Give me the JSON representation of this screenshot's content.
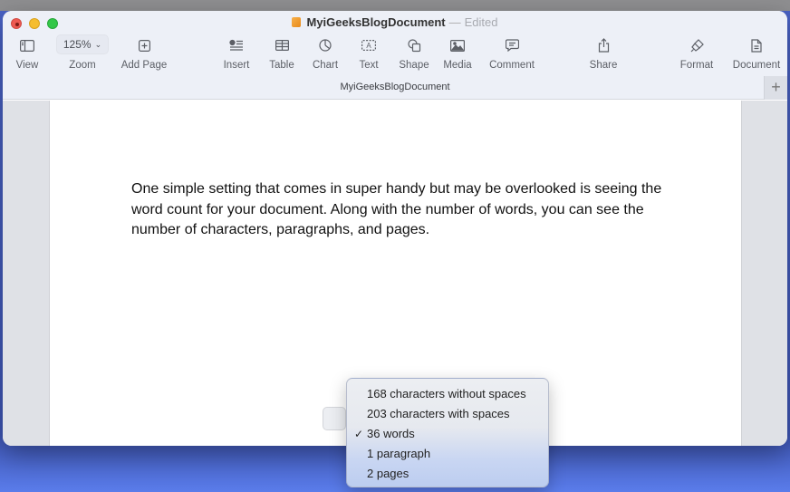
{
  "window": {
    "doc_title": "MyiGeeksBlogDocument",
    "separator": "—",
    "status": "Edited",
    "subtitle": "MyiGeeksBlogDocument"
  },
  "toolbar": {
    "view": "View",
    "zoom": "Zoom",
    "zoom_value": "125%",
    "add_page": "Add Page",
    "insert": "Insert",
    "table": "Table",
    "chart": "Chart",
    "text": "Text",
    "shape": "Shape",
    "media": "Media",
    "comment": "Comment",
    "share": "Share",
    "format": "Format",
    "document": "Document",
    "add_sheet": "+"
  },
  "document": {
    "paragraph": "One simple setting that comes in super handy but may be overlooked is seeing the word count for your document. Along with the number of words, you can see the number of characters, paragraphs, and pages."
  },
  "word_count_menu": {
    "items": [
      {
        "label": "168 characters without spaces",
        "checked": false
      },
      {
        "label": "203 characters with spaces",
        "checked": false
      },
      {
        "label": "36 words",
        "checked": true
      },
      {
        "label": "1 paragraph",
        "checked": false
      },
      {
        "label": "2 pages",
        "checked": false
      }
    ],
    "check_glyph": "✓"
  }
}
